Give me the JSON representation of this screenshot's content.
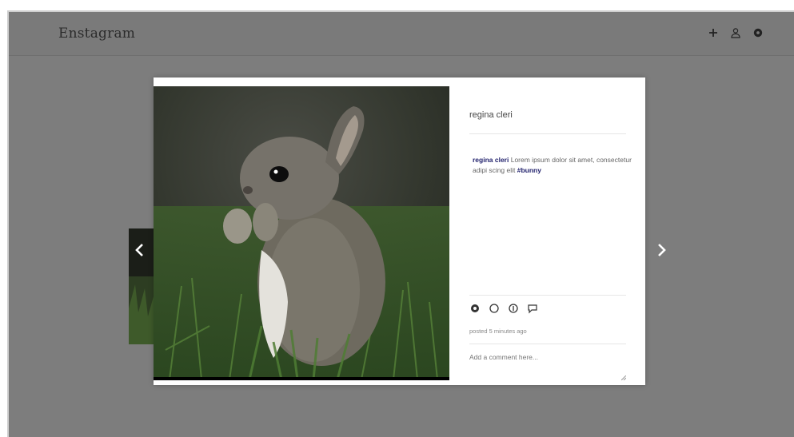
{
  "app": {
    "brand": "Enstagram"
  },
  "topbar": {
    "icons": [
      "plus-icon",
      "user-icon",
      "settings-icon"
    ]
  },
  "post": {
    "username": "regina cleri",
    "caption": {
      "author": "regina cleri",
      "text": " Lorem ipsum dolor sit amet, consectetur adipi scing elit",
      "tag": " #bunny"
    },
    "timestamp": "posted 5 minutes ago",
    "comment_placeholder": "Add a comment here..."
  },
  "colors": {
    "overlay": "#7d7d7d",
    "link": "#1f1f6b"
  }
}
